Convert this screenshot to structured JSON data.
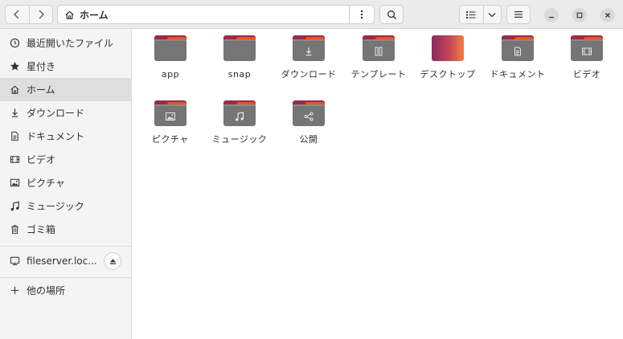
{
  "window": {
    "path": {
      "home_label": "ホーム"
    }
  },
  "sidebar": {
    "items": [
      {
        "label": "最近開いたファイル",
        "icon": "clock-icon"
      },
      {
        "label": "星付き",
        "icon": "star-icon"
      },
      {
        "label": "ホーム",
        "icon": "home-icon",
        "active": true
      },
      {
        "label": "ダウンロード",
        "icon": "download-icon"
      },
      {
        "label": "ドキュメント",
        "icon": "document-icon"
      },
      {
        "label": "ビデオ",
        "icon": "video-icon"
      },
      {
        "label": "ピクチャ",
        "icon": "picture-icon"
      },
      {
        "label": "ミュージック",
        "icon": "music-icon"
      },
      {
        "label": "ゴミ箱",
        "icon": "trash-icon"
      }
    ],
    "network": {
      "label": "fileserver.loc...",
      "icon": "network-drive-icon"
    },
    "other_locations": {
      "label": "他の場所",
      "icon": "plus-icon"
    }
  },
  "files": [
    {
      "name": "app",
      "icon": "folder-icon"
    },
    {
      "name": "snap",
      "icon": "folder-icon"
    },
    {
      "name": "ダウンロード",
      "icon": "download-folder-icon"
    },
    {
      "name": "テンプレート",
      "icon": "templates-folder-icon"
    },
    {
      "name": "デスクトップ",
      "icon": "desktop-folder-icon"
    },
    {
      "name": "ドキュメント",
      "icon": "documents-folder-icon"
    },
    {
      "name": "ビデオ",
      "icon": "videos-folder-icon"
    },
    {
      "name": "ピクチャ",
      "icon": "pictures-folder-icon"
    },
    {
      "name": "ミュージック",
      "icon": "music-folder-icon"
    },
    {
      "name": "公開",
      "icon": "public-folder-icon"
    }
  ],
  "colors": {
    "folder_body": "#757575",
    "folder_tab": "#9a2d46",
    "folder_accent": "#e95420",
    "sidebar_active": "#dedede"
  }
}
